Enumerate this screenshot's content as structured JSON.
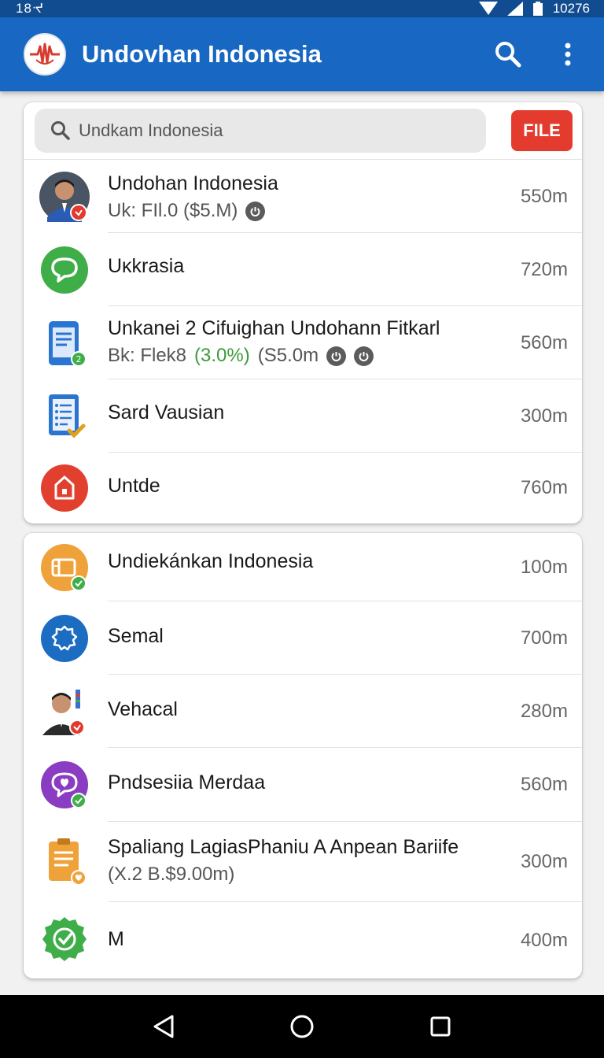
{
  "status": {
    "left": "18ᔵ",
    "time": "10276"
  },
  "app": {
    "title": "Undovhan Indonesia"
  },
  "search": {
    "placeholder": "Undkam Indonesia",
    "file_label": "FILE"
  },
  "list1": [
    {
      "title": "Undohan Indonesia",
      "sub": "Uk: FIl.0  ($5.M)",
      "power_icons": 1,
      "value": "550m",
      "icon": "person-avatar-icon"
    },
    {
      "title": "Uĸkrasia",
      "value": "720m",
      "icon": "chat-bubble-icon"
    },
    {
      "title": "Unkanei 2 Cifuighan Undohann Fitkarl",
      "sub": "Bk: Flek8",
      "sub_pct": "(3.0%)",
      "sub_tail": "(S5.0m",
      "power_icons": 2,
      "value": "560m",
      "icon": "tablet-document-icon"
    },
    {
      "title": "Sard Vausian",
      "value": "300m",
      "icon": "checklist-document-icon"
    },
    {
      "title": "Untde",
      "value": "760m",
      "icon": "home-box-icon"
    }
  ],
  "list2": [
    {
      "title": "Undiekánkan Indonesia",
      "value": "100m",
      "icon": "wallet-icon"
    },
    {
      "title": "Semal",
      "value": "700m",
      "icon": "gear-badge-icon"
    },
    {
      "title": "Vehacal",
      "value": "280m",
      "icon": "person-avatar-icon"
    },
    {
      "title": "Pndsesiia Merdaa",
      "value": "560m",
      "icon": "heart-chat-icon"
    },
    {
      "title": "Spaliang LagiasPhaniu A Anpean Bariife",
      "sub": "(X.2 B.$9.00m)",
      "value": "300m",
      "icon": "clipboard-icon"
    },
    {
      "title": "M",
      "value": "400m",
      "icon": "check-badge-icon"
    }
  ],
  "colors": {
    "app_bar": "#1767c3",
    "status_bar": "#114c91",
    "file_button": "#e33b2e",
    "accent_green": "#3b9b3b"
  }
}
